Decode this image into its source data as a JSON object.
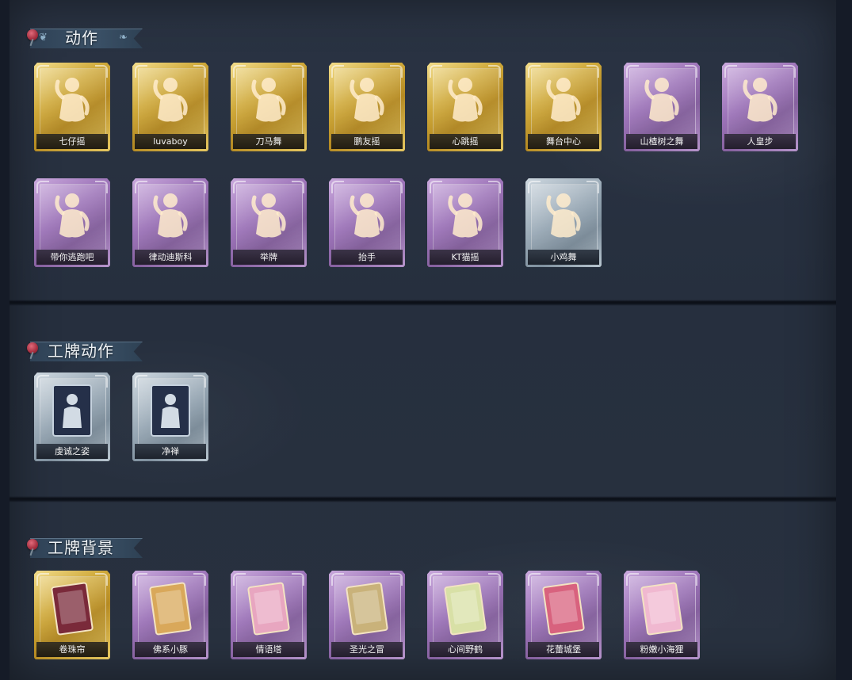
{
  "sections": [
    {
      "title": "动作",
      "items": [
        {
          "label": "七仔摇",
          "tier": "gold",
          "icon": "figure-icon"
        },
        {
          "label": "luvaboy",
          "tier": "gold",
          "icon": "figure-icon"
        },
        {
          "label": "刀马舞",
          "tier": "gold",
          "icon": "figure-icon"
        },
        {
          "label": "鹏友摇",
          "tier": "gold",
          "icon": "figure-icon"
        },
        {
          "label": "心跳摇",
          "tier": "gold",
          "icon": "figure-icon"
        },
        {
          "label": "舞台中心",
          "tier": "gold",
          "icon": "figure-icon"
        },
        {
          "label": "山楂树之舞",
          "tier": "purple",
          "icon": "figure-icon"
        },
        {
          "label": "人皇步",
          "tier": "purple",
          "icon": "figure-icon"
        },
        {
          "label": "带你逃跑吧",
          "tier": "purple",
          "icon": "figure-icon"
        },
        {
          "label": "律动迪斯科",
          "tier": "purple",
          "icon": "figure-icon"
        },
        {
          "label": "举牌",
          "tier": "purple",
          "icon": "figure-icon"
        },
        {
          "label": "抬手",
          "tier": "purple",
          "icon": "figure-icon"
        },
        {
          "label": "KT猫摇",
          "tier": "purple",
          "icon": "figure-icon"
        },
        {
          "label": "小鸡舞",
          "tier": "silver",
          "icon": "figure-icon"
        }
      ]
    },
    {
      "title": "工牌动作",
      "items": [
        {
          "label": "虔诚之姿",
          "tier": "silver",
          "icon": "badge-figure-icon"
        },
        {
          "label": "净禅",
          "tier": "silver",
          "icon": "badge-figure-icon"
        }
      ]
    },
    {
      "title": "工牌背景",
      "items": [
        {
          "label": "卷珠帘",
          "tier": "gold",
          "icon": "badge-background-icon"
        },
        {
          "label": "佛系小豚",
          "tier": "purple",
          "icon": "badge-background-icon"
        },
        {
          "label": "情语塔",
          "tier": "purple",
          "icon": "badge-background-icon"
        },
        {
          "label": "圣光之冒",
          "tier": "purple",
          "icon": "badge-background-icon"
        },
        {
          "label": "心间野鹤",
          "tier": "purple",
          "icon": "badge-background-icon"
        },
        {
          "label": "花蕾城堡",
          "tier": "purple",
          "icon": "badge-background-icon"
        },
        {
          "label": "粉嫩小海狸",
          "tier": "purple",
          "icon": "badge-background-icon"
        }
      ]
    }
  ],
  "colors": {
    "gold": "#cfa93a",
    "purple": "#9c73b8",
    "silver": "#97a7b4",
    "background": "#262f3e"
  }
}
